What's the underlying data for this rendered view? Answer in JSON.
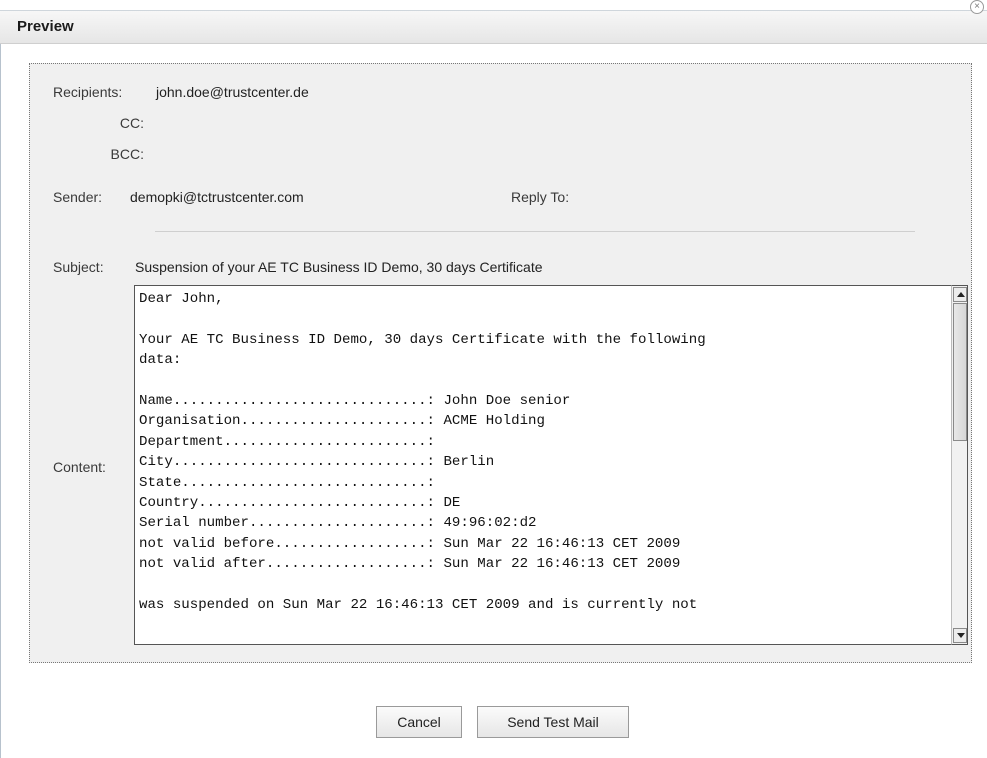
{
  "dialog": {
    "title": "Preview",
    "close_icon": "close-circle-x",
    "close_glyph": "×"
  },
  "email": {
    "recipients_label": "Recipients:",
    "recipients_value": "john.doe@trustcenter.de",
    "cc_label": "CC:",
    "cc_value": "",
    "bcc_label": "BCC:",
    "bcc_value": "",
    "sender_label": "Sender:",
    "sender_value": "demopki@tctrustcenter.com",
    "reply_to_label": "Reply To:",
    "reply_to_value": "",
    "subject_label": "Subject:",
    "subject_value": "Suspension of your AE TC Business ID Demo, 30 days Certificate",
    "content_label": "Content:",
    "content_value": "Dear John,\n\nYour AE TC Business ID Demo, 30 days Certificate with the following\ndata:\n\nName..............................: John Doe senior\nOrganisation......................: ACME Holding\nDepartment........................:\nCity..............................: Berlin\nState.............................:\nCountry...........................: DE\nSerial number.....................: 49:96:02:d2\nnot valid before..................: Sun Mar 22 16:46:13 CET 2009\nnot valid after...................: Sun Mar 22 16:46:13 CET 2009\n\nwas suspended on Sun Mar 22 16:46:13 CET 2009 and is currently not"
  },
  "buttons": {
    "cancel_label": "Cancel",
    "send_test_mail_label": "Send Test Mail"
  },
  "colors": {
    "panel_background": "#f0f0f0",
    "title_bar": "#e9e9e9",
    "border": "#777777"
  }
}
